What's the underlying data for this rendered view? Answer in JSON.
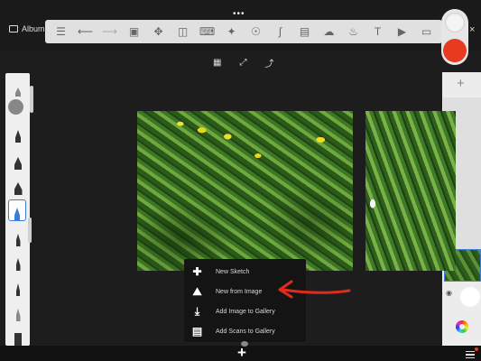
{
  "top_bar": {
    "album_label": "Album",
    "more_label": "•••",
    "close_label": "×",
    "toolbar_icons": [
      "list-icon",
      "undo-icon",
      "redo-icon",
      "crop-icon",
      "move-icon",
      "layers-icon",
      "ruler-icon",
      "symmetry-icon",
      "perspective-icon",
      "curve-icon",
      "image-icon",
      "stamp-icon",
      "fill-icon",
      "text-icon",
      "video-icon",
      "frame-icon"
    ]
  },
  "center_icons": [
    "grid-view-icon",
    "fullscreen-icon",
    "export-icon"
  ],
  "right_panel": {
    "add_label": "+"
  },
  "popup_menu": {
    "items": [
      {
        "icon": "plus-icon",
        "label": "New Sketch"
      },
      {
        "icon": "new-from-image-icon",
        "label": "New from Image"
      },
      {
        "icon": "add-image-icon",
        "label": "Add Image to Gallery"
      },
      {
        "icon": "add-scans-icon",
        "label": "Add Scans to Gallery"
      }
    ]
  },
  "bottom_bar": {
    "plus_label": "+"
  },
  "colors": {
    "accent": "#3b7dd8",
    "brush_color": "#e63b1f",
    "arrow_color": "#e02a1c"
  }
}
